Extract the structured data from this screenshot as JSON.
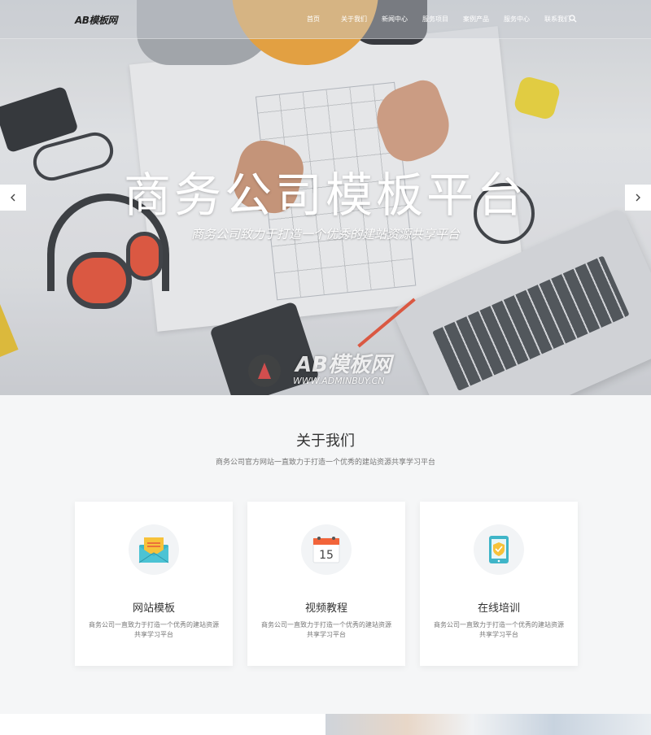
{
  "nav": {
    "logo": "AB模板网",
    "items": [
      "首页",
      "关于我们",
      "新闻中心",
      "服务项目",
      "案例产品",
      "服务中心",
      "联系我们"
    ]
  },
  "hero": {
    "title": "商务公司模板平台",
    "subtitle": "商务公司致力于打造一个优秀的建站资源共享平台",
    "watermark_main": "AB模板网",
    "watermark_url": "WWW.ADMINBUY.CN"
  },
  "about": {
    "title": "关于我们",
    "subtitle": "商务公司官方网站一直致力于打造一个优秀的建站资源共享学习平台",
    "cards": [
      {
        "icon": "envelope-icon",
        "title": "网站模板",
        "desc": "商务公司一直致力于打造一个优秀的建站资源共享学习平台"
      },
      {
        "icon": "calendar-icon",
        "title": "视频教程",
        "desc": "商务公司一直致力于打造一个优秀的建站资源共享学习平台",
        "day": "15"
      },
      {
        "icon": "tablet-shield-icon",
        "title": "在线培训",
        "desc": "商务公司一直致力于打造一个优秀的建站资源共享学习平台"
      }
    ]
  },
  "colors": {
    "accent_orange": "#f2643a",
    "accent_teal": "#3fb5c8",
    "accent_yellow": "#f7c23a"
  }
}
